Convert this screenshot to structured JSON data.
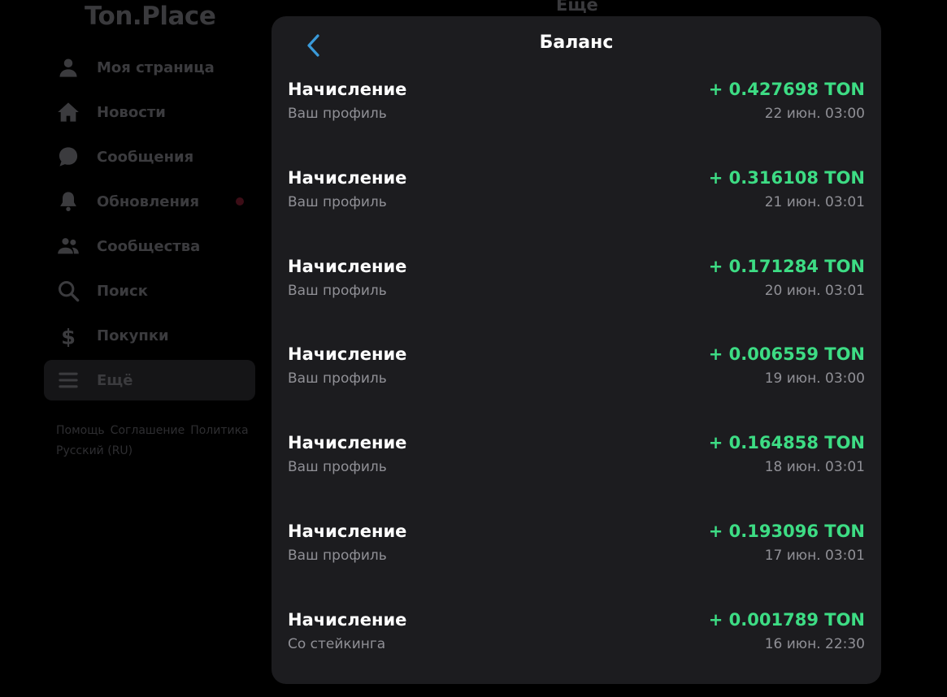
{
  "app": {
    "logo": "Ton.Place",
    "background_header_title": "Ещё"
  },
  "sidebar": {
    "items": [
      {
        "label": "Моя страница",
        "icon": "user-icon"
      },
      {
        "label": "Новости",
        "icon": "home-icon"
      },
      {
        "label": "Сообщения",
        "icon": "chat-bubble-icon"
      },
      {
        "label": "Обновления",
        "icon": "bell-icon",
        "has_dot": true
      },
      {
        "label": "Сообщества",
        "icon": "group-icon"
      },
      {
        "label": "Поиск",
        "icon": "search-icon"
      },
      {
        "label": "Покупки",
        "icon": "dollar-icon"
      },
      {
        "label": "Ещё",
        "icon": "menu-icon",
        "active": true
      }
    ],
    "footer_links": [
      "Помощь",
      "Соглашение",
      "Политика",
      "Русский (RU)"
    ]
  },
  "modal": {
    "title": "Баланс",
    "back_icon": "chevron-left-icon",
    "transactions": [
      {
        "type": "Начисление",
        "source": "Ваш профиль",
        "amount": "+ 0.427698 TON",
        "date": "22 июн. 03:00"
      },
      {
        "type": "Начисление",
        "source": "Ваш профиль",
        "amount": "+ 0.316108 TON",
        "date": "21 июн. 03:01"
      },
      {
        "type": "Начисление",
        "source": "Ваш профиль",
        "amount": "+ 0.171284 TON",
        "date": "20 июн. 03:01"
      },
      {
        "type": "Начисление",
        "source": "Ваш профиль",
        "amount": "+ 0.006559 TON",
        "date": "19 июн. 03:00"
      },
      {
        "type": "Начисление",
        "source": "Ваш профиль",
        "amount": "+ 0.164858 TON",
        "date": "18 июн. 03:01"
      },
      {
        "type": "Начисление",
        "source": "Ваш профиль",
        "amount": "+ 0.193096 TON",
        "date": "17 июн. 03:01"
      },
      {
        "type": "Начисление",
        "source": "Со стейкинга",
        "amount": "+ 0.001789 TON",
        "date": "16 июн. 22:30"
      }
    ]
  },
  "colors": {
    "background": "#000000",
    "modal_background": "#1c1c1f",
    "amount_positive": "#3ddc84",
    "accent_back": "#3a9ad9",
    "secondary_text": "#909096",
    "notification_dot": "#3c0d16"
  }
}
